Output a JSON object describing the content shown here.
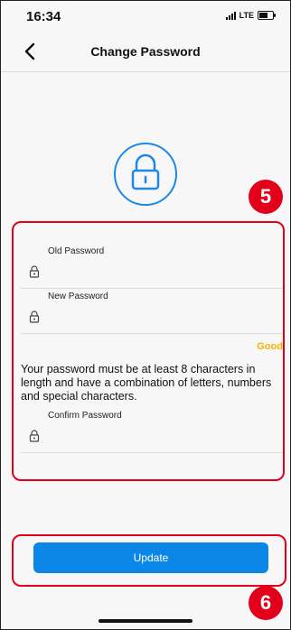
{
  "status": {
    "time": "16:34",
    "network": "LTE"
  },
  "header": {
    "title": "Change Password"
  },
  "form": {
    "old_password_label": "Old Password",
    "new_password_label": "New Password",
    "strength_label": "Good",
    "hint": "Your password must be at least 8 characters in length and have a combination of letters, numbers and special characters.",
    "confirm_password_label": "Confirm Password"
  },
  "actions": {
    "update_label": "Update"
  },
  "callouts": {
    "form_marker": "5",
    "button_marker": "6"
  },
  "colors": {
    "accent": "#0b86e6",
    "callout": "#e3001b",
    "strength_good": "#f4b400"
  }
}
